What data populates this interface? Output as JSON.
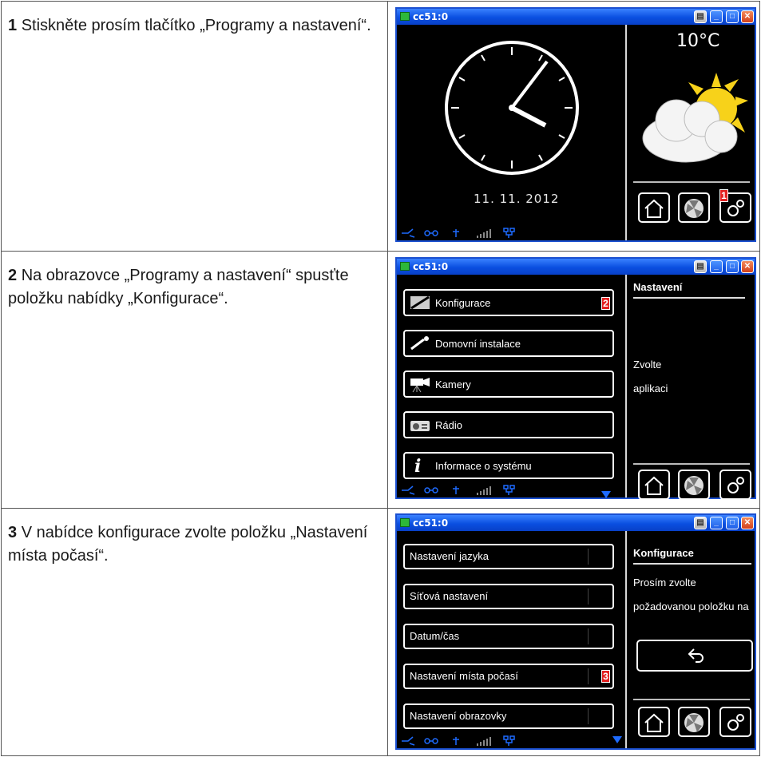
{
  "steps": [
    {
      "number": "1",
      "text": "Stiskněte prosím tlačítko „Programy a nastavení“.",
      "window_title": "cc51:0",
      "temperature": "10°C",
      "date": "11. 11. 2012",
      "marker": "1"
    },
    {
      "number": "2",
      "text": "Na obrazovce „Programy a nastavení“ spusťte položku nabídky „Konfigurace“.",
      "window_title": "cc51:0",
      "menu": [
        "Konfigurace",
        "Domovní instalace",
        "Kamery",
        "Rádio",
        "Informace o systému"
      ],
      "side_title": "Nastavení",
      "side_text": [
        "Zvolte",
        "aplikaci"
      ],
      "marker": "2"
    },
    {
      "number": "3",
      "text": "V nabídce konfigurace zvolte položku „Nastavení místa počasí“.",
      "window_title": "cc51:0",
      "menu": [
        "Nastavení jazyka",
        "Síťová nastavení",
        "Datum/čas",
        "Nastavení místa počasí",
        "Nastavení obrazovky"
      ],
      "side_title": "Konfigurace",
      "side_text": [
        "Prosím zvolte",
        "požadovanou položku na"
      ],
      "marker": "3"
    }
  ],
  "icons": {
    "window_icon": "terminal-icon",
    "title_buttons": [
      "printer-icon",
      "minimize-icon",
      "maximize-icon",
      "close-icon"
    ],
    "bottom_buttons": [
      "home-icon",
      "fan-icon",
      "gear-icon"
    ],
    "weather": "partly-cloudy-icon",
    "status_icons": [
      "signal-icon",
      "network-icon",
      "antenna-icon",
      "signal-bars-icon",
      "lan-icon"
    ]
  },
  "colors": {
    "titlebar": "#0a4fe0",
    "marker": "#e32121",
    "screen_bg": "#000000",
    "status_blue": "#1e6bff"
  }
}
